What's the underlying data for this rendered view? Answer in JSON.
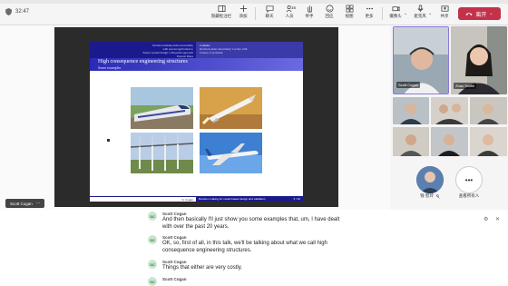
{
  "title_strip": "",
  "topbar": {
    "timer": "32:47",
    "buttons": [
      {
        "label": "隐藏批注栏",
        "icon": "toggle-pane-icon"
      },
      {
        "label": "添加",
        "icon": "add-icon"
      },
      {
        "label": "聊天",
        "icon": "chat-icon"
      },
      {
        "label": "人员",
        "icon": "people-icon",
        "count": "16"
      },
      {
        "label": "举手",
        "icon": "raise-hand-icon"
      },
      {
        "label": "回应",
        "icon": "react-icon"
      },
      {
        "label": "视图",
        "icon": "view-icon"
      },
      {
        "label": "更多",
        "icon": "more-icon"
      },
      {
        "label": "摄像头",
        "icon": "camera-icon"
      },
      {
        "label": "麦克风",
        "icon": "mic-icon"
      },
      {
        "label": "共享",
        "icon": "share-icon"
      }
    ],
    "leave_label": "离开"
  },
  "slide": {
    "header_left": [
      "Decision making under uncertainty",
      "with special application to",
      "Sensor system design: a Bayesian approach",
      "Pearson Dates"
    ],
    "header_right_title": "Contents",
    "header_right_lines": [
      "Decision under uncertainty: Lecture with",
      "Feature of problems"
    ],
    "title": "High consequence engineering structures",
    "subtitle": "Some examples",
    "footer_left": "S. Cogan",
    "footer_right": "Decision making for model based design and validation",
    "footer_page": "3 / 10"
  },
  "speaker_label": "Scott Cogan",
  "gallery": {
    "tiles": [
      {
        "name": "Scott Cogan"
      },
      {
        "name": "Zhao Yanfei"
      }
    ],
    "avatars": [
      {
        "name": "钱 智玲",
        "initials": "",
        "mic": "mic-off-icon"
      },
      {
        "name": "查看所有人",
        "initials": "•••"
      }
    ]
  },
  "messages": [
    {
      "initials": "SC",
      "name": "Scott Cogan",
      "lines": [
        "And then basically I'll just show you some examples that, um, I have dealt",
        "with over the past 20 years."
      ]
    },
    {
      "initials": "SC",
      "name": "Scott Cogan",
      "lines": [
        "OK, so, first of all, in this talk, we'll be talking about what we call high",
        "consequence engineering structures."
      ]
    },
    {
      "initials": "SC",
      "name": "Scott Cogan",
      "lines": [
        "Things that either are very costly."
      ]
    },
    {
      "initials": "SC",
      "name": "Scott Cogan",
      "lines": [
        ""
      ]
    }
  ],
  "colors": {
    "leave": "#c4314b",
    "slide_header": "#1a1a8c",
    "slide_title_bar": "#2a2ab5"
  }
}
